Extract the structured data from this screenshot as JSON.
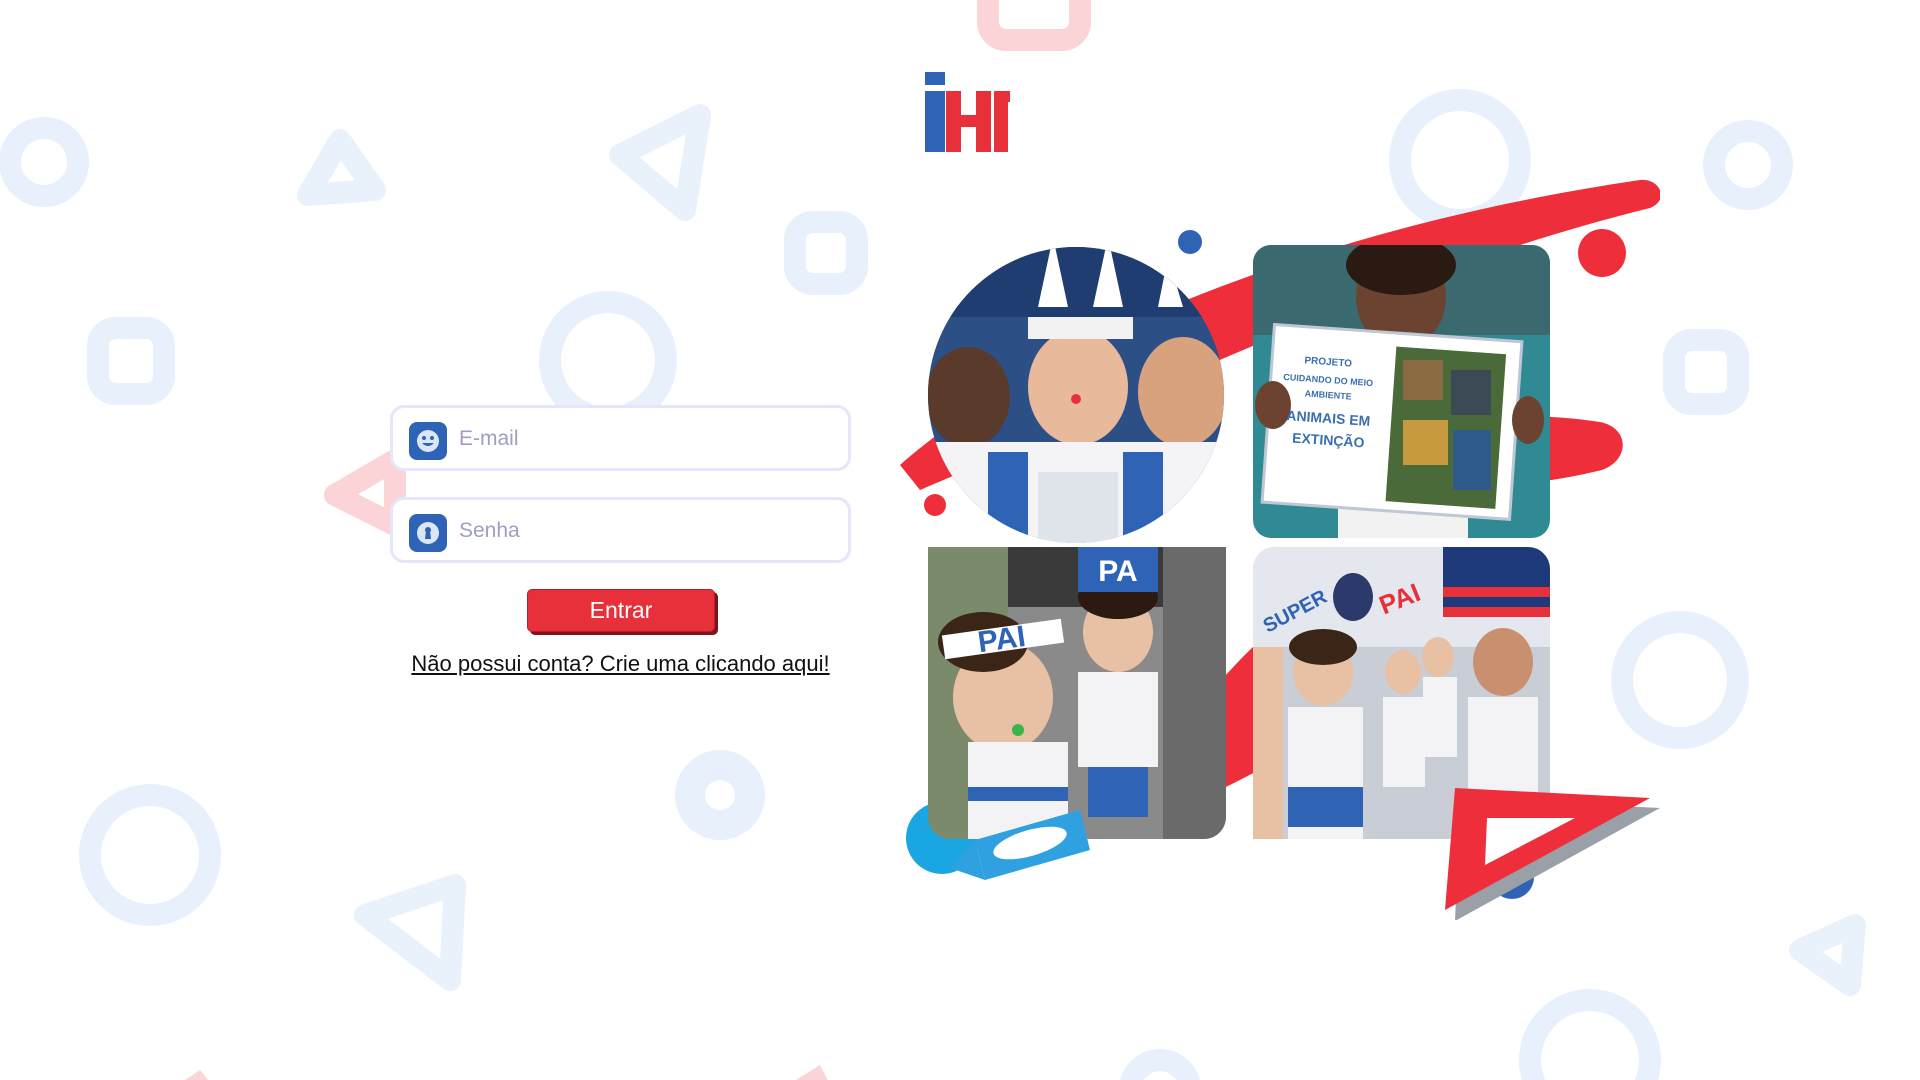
{
  "brand": {
    "logo_text": "IHF",
    "blue": "#2f63b5",
    "red": "#e8303a"
  },
  "login": {
    "email_placeholder": "E-mail",
    "password_placeholder": "Senha",
    "submit_label": "Entrar",
    "signup_link": "Não possui conta? Crie uma clicando aqui!"
  },
  "icons": {
    "email": "smiley-face-icon",
    "password": "keyhole-lock-icon"
  },
  "collage": {
    "photo_2_sign": [
      "PROJETO",
      "CUIDANDO DO MEIO",
      "AMBIENTE",
      "ANIMAIS EM",
      "EXTINÇÃO"
    ],
    "photo_3_headbands": [
      "PAI",
      "PA"
    ],
    "photo_4_banner": [
      "SUPER",
      "PAI"
    ]
  }
}
